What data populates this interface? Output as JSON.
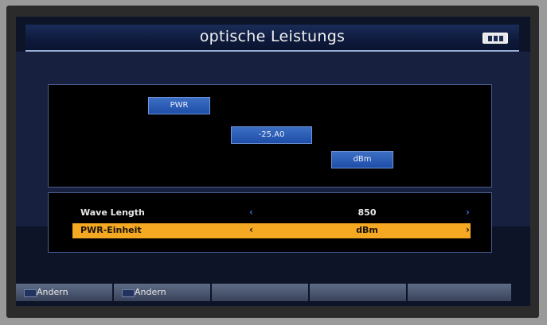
{
  "header": {
    "title": "optische Leistungs"
  },
  "display": {
    "pwr_label": "PWR",
    "pwr_value": "-25.A0",
    "unit": "dBm"
  },
  "settings": {
    "rows": [
      {
        "label": "Wave Length",
        "value": "850",
        "selected": false
      },
      {
        "label": "PWR-Einheit",
        "value": "dBm",
        "selected": true
      }
    ]
  },
  "footer": {
    "buttons": [
      "Andern",
      "Andern",
      "",
      "",
      ""
    ]
  },
  "colors": {
    "accent": "#f5a822",
    "tag": "#2a5bb5",
    "background": "#0d1428"
  },
  "icons": {
    "battery": "battery-icon",
    "left": "chevron-left-icon",
    "right": "chevron-right-icon"
  }
}
